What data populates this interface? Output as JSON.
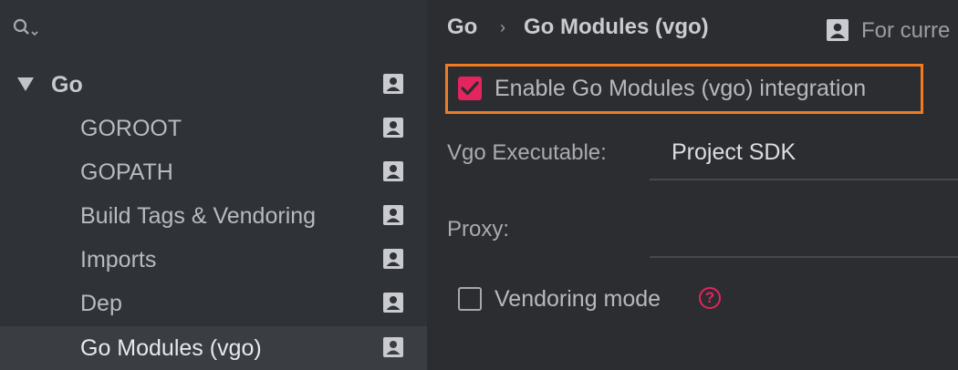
{
  "search": {
    "icon": "search-icon"
  },
  "tree": {
    "root": {
      "label": "Go",
      "expanded": true
    },
    "children": [
      {
        "label": "GOROOT",
        "selected": false
      },
      {
        "label": "GOPATH",
        "selected": false
      },
      {
        "label": "Build Tags & Vendoring",
        "selected": false
      },
      {
        "label": "Imports",
        "selected": false
      },
      {
        "label": "Dep",
        "selected": false
      },
      {
        "label": "Go Modules (vgo)",
        "selected": true
      }
    ]
  },
  "header": {
    "breadcrumb_root": "Go",
    "breadcrumb_separator": "›",
    "breadcrumb_current": "Go Modules (vgo)",
    "scope_text": "For curre"
  },
  "settings": {
    "enable_vgo": {
      "label": "Enable Go Modules (vgo) integration",
      "checked": true
    },
    "vgo_executable": {
      "label": "Vgo Executable:",
      "value": "Project SDK"
    },
    "proxy": {
      "label": "Proxy:",
      "value": ""
    },
    "vendoring_mode": {
      "label": "Vendoring mode",
      "checked": false,
      "help": "?"
    }
  },
  "colors": {
    "accent": "#e3245f",
    "highlight_border": "#f07b20",
    "sidebar_bg": "#2f3237",
    "main_bg": "#2b2d30",
    "selected_row": "#3a3d42"
  }
}
